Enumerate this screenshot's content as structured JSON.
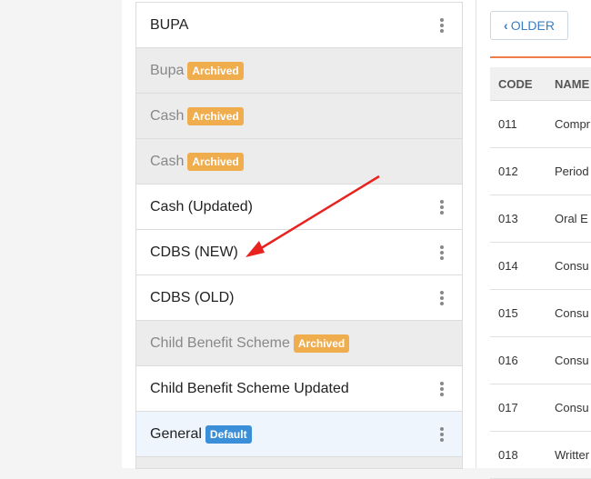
{
  "schemes": [
    {
      "label": "BUPA",
      "badge": "",
      "type": "normal"
    },
    {
      "label": "Bupa",
      "badge": "Archived",
      "type": "archived"
    },
    {
      "label": "Cash",
      "badge": "Archived",
      "type": "archived"
    },
    {
      "label": "Cash",
      "badge": "Archived",
      "type": "archived"
    },
    {
      "label": "Cash (Updated)",
      "badge": "",
      "type": "normal"
    },
    {
      "label": "CDBS (NEW)",
      "badge": "",
      "type": "normal"
    },
    {
      "label": "CDBS (OLD)",
      "badge": "",
      "type": "normal"
    },
    {
      "label": "Child Benefit Scheme",
      "badge": "Archived",
      "type": "archived"
    },
    {
      "label": "Child Benefit Scheme Updated",
      "badge": "",
      "type": "normal"
    },
    {
      "label": "General",
      "badge": "Default",
      "type": "default"
    }
  ],
  "older_button": {
    "label": "OLDER"
  },
  "table": {
    "headers": {
      "code": "CODE",
      "name": "NAME"
    },
    "rows": [
      {
        "code": "011",
        "name": "Compr"
      },
      {
        "code": "012",
        "name": "Period"
      },
      {
        "code": "013",
        "name": "Oral E"
      },
      {
        "code": "014",
        "name": "Consu"
      },
      {
        "code": "015",
        "name": "Consu"
      },
      {
        "code": "016",
        "name": "Consu"
      },
      {
        "code": "017",
        "name": "Consu"
      },
      {
        "code": "018",
        "name": "Writter"
      }
    ]
  },
  "colors": {
    "archived_badge": "#f0ad4e",
    "default_badge": "#3a8fd8",
    "accent_rule": "#f07c4a",
    "annotation_arrow": "#e8231f"
  }
}
